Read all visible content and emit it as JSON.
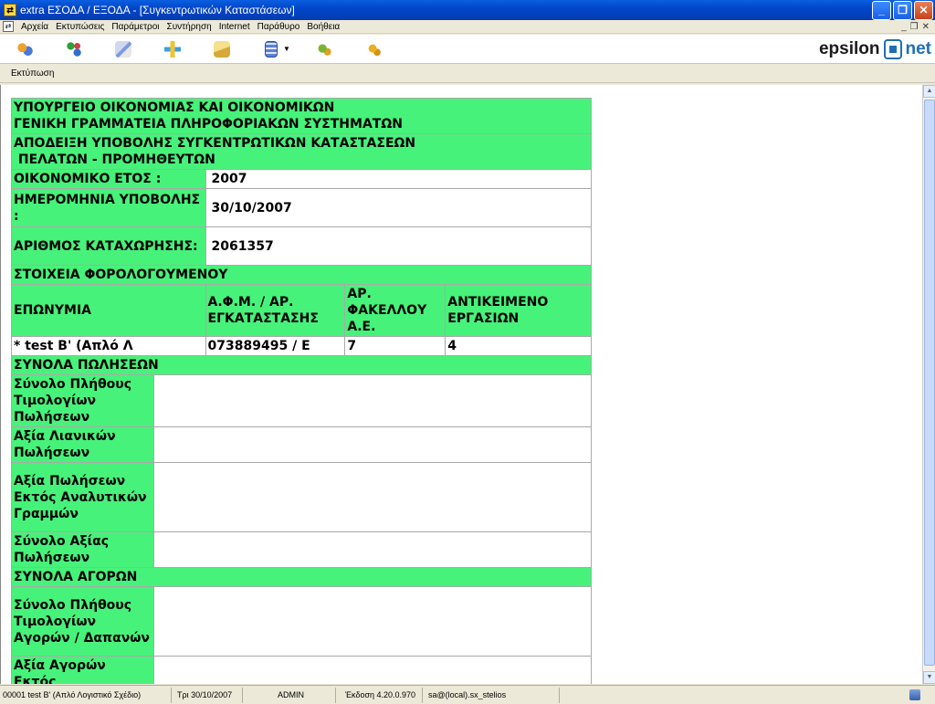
{
  "window": {
    "title": "extra ΕΣΟΔΑ / ΕΞΟΔΑ - [Συγκεντρωτικών Καταστάσεων]"
  },
  "menu": [
    "Αρχεία",
    "Εκτυπώσεις",
    "Παράμετροι",
    "Συντήρηση",
    "Internet",
    "Παράθυρο",
    "Βοήθεια"
  ],
  "brand": {
    "left": "epsilon",
    "right": "net"
  },
  "subbar": {
    "print_label": "Εκτύπωση"
  },
  "report": {
    "header1": "ΥΠΟΥΡΓΕΙΟ ΟΙΚΟΝΟΜΙΑΣ ΚΑΙ ΟΙΚΟΝΟΜΙΚΩΝ",
    "header2": "ΓΕΝΙΚΗ ΓΡΑΜΜΑΤΕΙΑ ΠΛΗΡΟΦΟΡΙΑΚΩΝ ΣΥΣΤΗΜΑΤΩΝ",
    "header3": "ΑΠΟΔΕΙΞΗ ΥΠΟΒΟΛΗΣ ΣΥΓΚΕΝΤΡΩΤΙΚΩΝ ΚΑΤΑΣΤΑΣΕΩΝ",
    "header4": " ΠΕΛΑΤΩΝ - ΠΡΟΜΗΘΕΥΤΩΝ",
    "fiscal_year_label": "ΟΙΚΟΝΟΜΙΚΟ ΕΤΟΣ :",
    "fiscal_year_value": "2007",
    "submission_date_label": "ΗΜΕΡΟΜΗΝΙΑ ΥΠΟΒΟΛΗΣ :",
    "submission_date_value": "30/10/2007",
    "registration_label": "ΑΡΙΘΜΟΣ ΚΑΤΑΧΩΡΗΣΗΣ:",
    "registration_value": "2061357",
    "taxpayer_section": "ΣΤΟΙΧΕΙΑ ΦΟΡΟΛΟΓΟΥΜΕΝΟΥ",
    "col_name": "ΕΠΩΝΥΜΙΑ",
    "col_afm": "Α.Φ.Μ. / ΑΡ. ΕΓΚΑΤΑΣΤΑΣΗΣ",
    "col_folder": "ΑΡ. ΦΑΚΕΛΛΟΥ Α.Ε.",
    "col_object": "ΑΝΤΙΚΕΙΜΕΝΟ ΕΡΓΑΣΙΩΝ",
    "row_name": "* test B' (Απλό Λ",
    "row_afm": "073889495 / E",
    "row_folder": "7",
    "row_object": "4",
    "sales_section": "ΣΥΝΟΛΑ ΠΩΛΗΣΕΩΝ",
    "sales_invoices_count": "Σύνολο Πλήθους Τιμολογίων Πωλήσεων",
    "retail_sales_value": "Αξία Λιανικών Πωλήσεων",
    "sales_outside_lines": "Αξία Πωλήσεων Εκτός Αναλυτικών Γραμμών",
    "total_sales_value": "Σύνολο Αξίας Πωλήσεων",
    "purchases_section": "ΣΥΝΟΛΑ ΑΓΟΡΩΝ",
    "purchase_invoices_count": "Σύνολο Πλήθους Τιμολογίων Αγορών / Δαπανών",
    "purchases_outside": "Αξία Αγορών Εκτός"
  },
  "status": {
    "company": "00001 test B' (Απλό Λογιστικό Σχέδιο)",
    "date": "Τρι 30/10/2007",
    "user": "ADMIN",
    "version": "Έκδοση 4.20.0.970",
    "connection": "sa@(local).sx_stelios"
  },
  "colors": {
    "green": "#47f27a",
    "titlebar": "#0246c9"
  }
}
